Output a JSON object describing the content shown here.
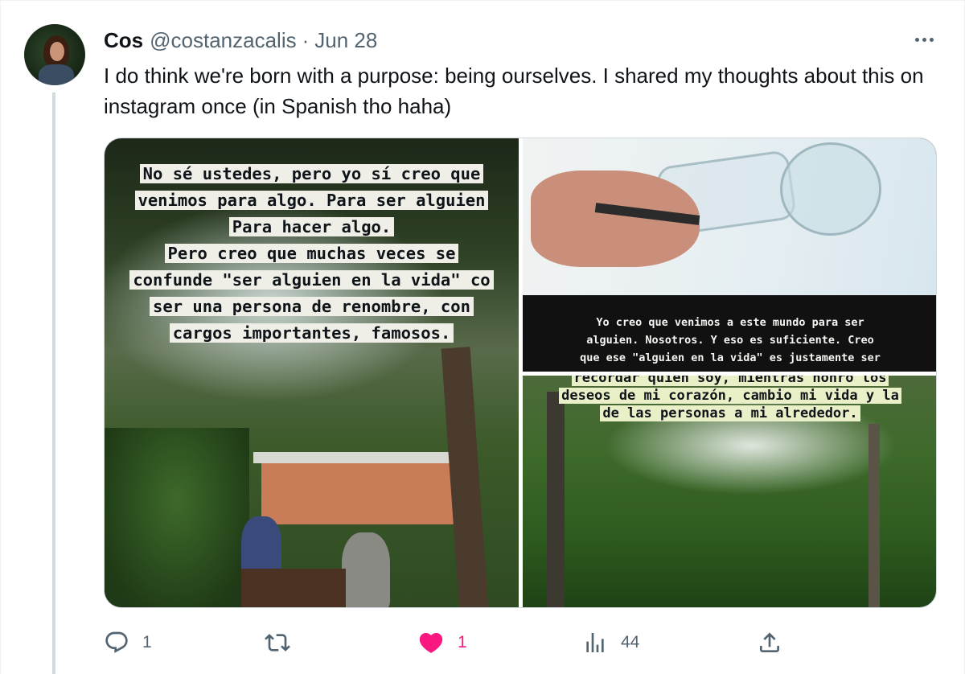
{
  "tweet": {
    "author_name": "Cos",
    "handle": "@costanzacalis",
    "separator": "·",
    "date": "Jun 28",
    "text": "I do think we're born with a purpose: being ourselves. I shared my thoughts about this on instagram once (in Spanish tho haha)"
  },
  "media": {
    "left_caption": [
      "No sé ustedes, pero yo sí creo que",
      "venimos para algo. Para ser alguien",
      "Para hacer algo.",
      "Pero creo que muchas veces se",
      "confunde \"ser alguien en la vida\" co",
      "ser una persona de renombre, con",
      "cargos importantes, famosos."
    ],
    "top_right_caption": [
      "Yo creo que venimos a este mundo para ser",
      "alguien. Nosotros. Y eso es suficiente. Creo",
      "que ese \"alguien en la vida\" es justamente ser"
    ],
    "bottom_right_caption": [
      "recordar quien soy, mientras honro los",
      "deseos de mi corazón, cambio mi vida y la",
      "de las personas a mi alrededor."
    ]
  },
  "actions": {
    "reply_count": "1",
    "retweet_count": "",
    "like_count": "1",
    "views_count": "44"
  },
  "colors": {
    "like_active": "#f91880",
    "secondary_text": "#536471",
    "thread_line": "#cfd9de"
  },
  "icons": {
    "reply": "reply-icon",
    "retweet": "retweet-icon",
    "like": "heart-filled-icon",
    "views": "views-icon",
    "share": "share-icon",
    "more": "more-icon"
  }
}
